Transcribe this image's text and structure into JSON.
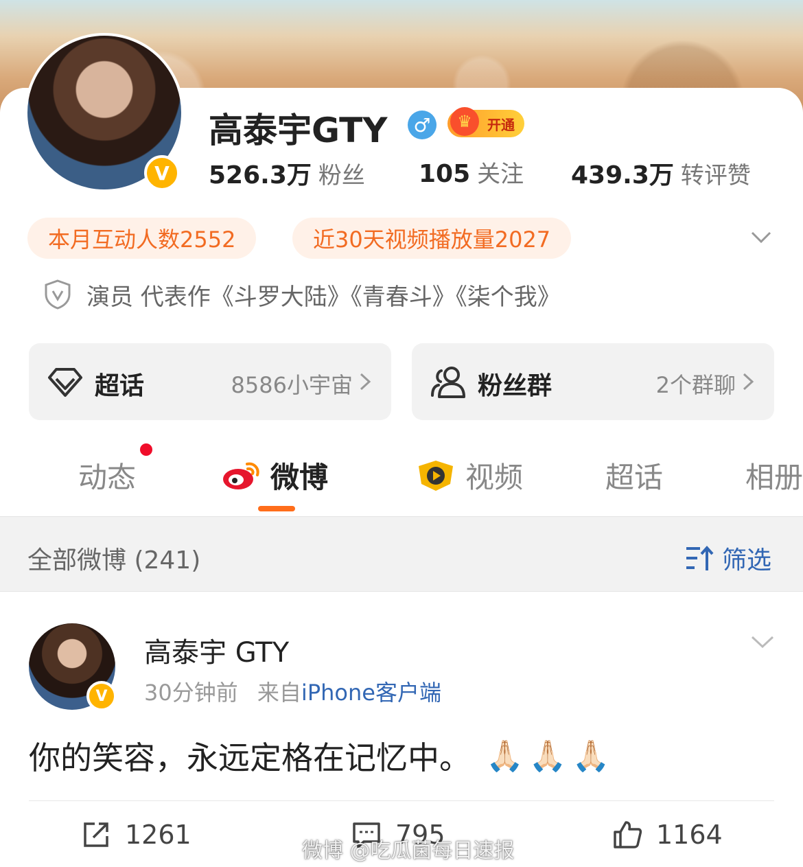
{
  "profile": {
    "name": "高泰宇GTY",
    "gender_symbol": "♂",
    "vip_label": "开通",
    "verified_symbol": "V",
    "stats": [
      {
        "value": "526.3万",
        "label": "粉丝"
      },
      {
        "value": "105",
        "label": "关注"
      },
      {
        "value": "439.3万",
        "label": "转评赞"
      }
    ],
    "chips": [
      "本月互动人数2552",
      "近30天视频播放量2027"
    ],
    "description": "演员 代表作《斗罗大陆》《青春斗》《柒个我》"
  },
  "boxes": {
    "super_topic": {
      "label": "超话",
      "right": "8586小宇宙"
    },
    "fan_group": {
      "label": "粉丝群",
      "right": "2个群聊"
    }
  },
  "tabs": [
    "动态",
    "微博",
    "视频",
    "超话",
    "相册"
  ],
  "filter": {
    "all_label": "全部微博 (241)",
    "sift_label": "筛选"
  },
  "post": {
    "author": "高泰宇 GTY",
    "time": "30分钟前",
    "source_prefix": "来自",
    "source": "iPhone客户端",
    "text": "你的笑容，永远定格在记忆中。",
    "emojis": [
      "🙏🏻",
      "🙏🏻",
      "🙏🏻"
    ],
    "reposts": "1261",
    "comments": "795",
    "likes": "1164"
  },
  "watermark": "微博 @吃瓜菌每日速报",
  "colors": {
    "accent": "#ff6d1a",
    "link": "#3267b4",
    "chip_text": "#f26b22",
    "chip_bg": "#fff1e8"
  }
}
